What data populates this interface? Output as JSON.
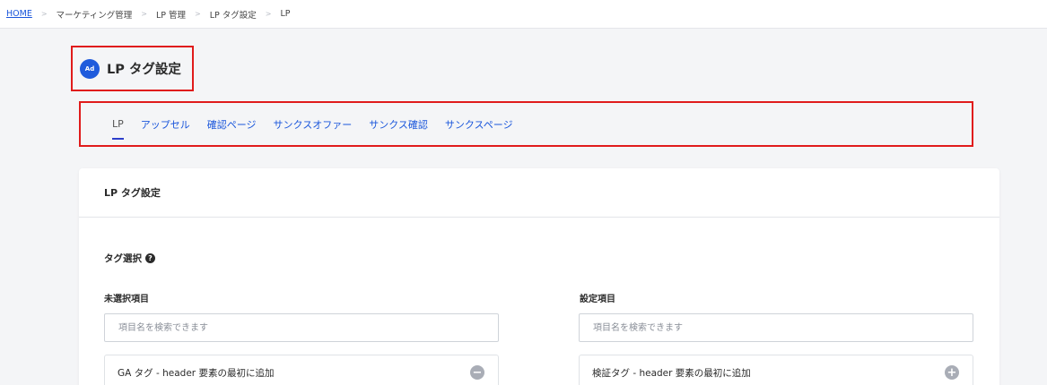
{
  "breadcrumb": {
    "items": [
      "HOME",
      "マーケティング管理",
      "LP 管理",
      "LP タグ設定",
      "LP"
    ],
    "separator": ">"
  },
  "header": {
    "icon_text": "Ad",
    "title": "LP タグ設定"
  },
  "tabs": [
    {
      "label": "LP",
      "active": true
    },
    {
      "label": "アップセル",
      "active": false
    },
    {
      "label": "確認ページ",
      "active": false
    },
    {
      "label": "サンクスオファー",
      "active": false
    },
    {
      "label": "サンクス確認",
      "active": false
    },
    {
      "label": "サンクスページ",
      "active": false
    }
  ],
  "card": {
    "title": "LP タグ設定",
    "section_label": "タグ選択",
    "help_icon": "question-circle-icon",
    "left": {
      "label": "未選択項目",
      "search_placeholder": "項目名を検索できます",
      "items": [
        {
          "label": "GA タグ - header 要素の最初に追加",
          "action": "−"
        }
      ]
    },
    "right": {
      "label": "設定項目",
      "search_placeholder": "項目名を検索できます",
      "items": [
        {
          "label": "検証タグ - header 要素の最初に追加",
          "action": "+"
        }
      ]
    }
  },
  "colors": {
    "accent": "#1a56db",
    "highlight_border": "#e01b1b",
    "tab_underline": "#2c3ecb",
    "icon_bg": "#1f5bdc",
    "button_gray": "#a9adb6"
  }
}
